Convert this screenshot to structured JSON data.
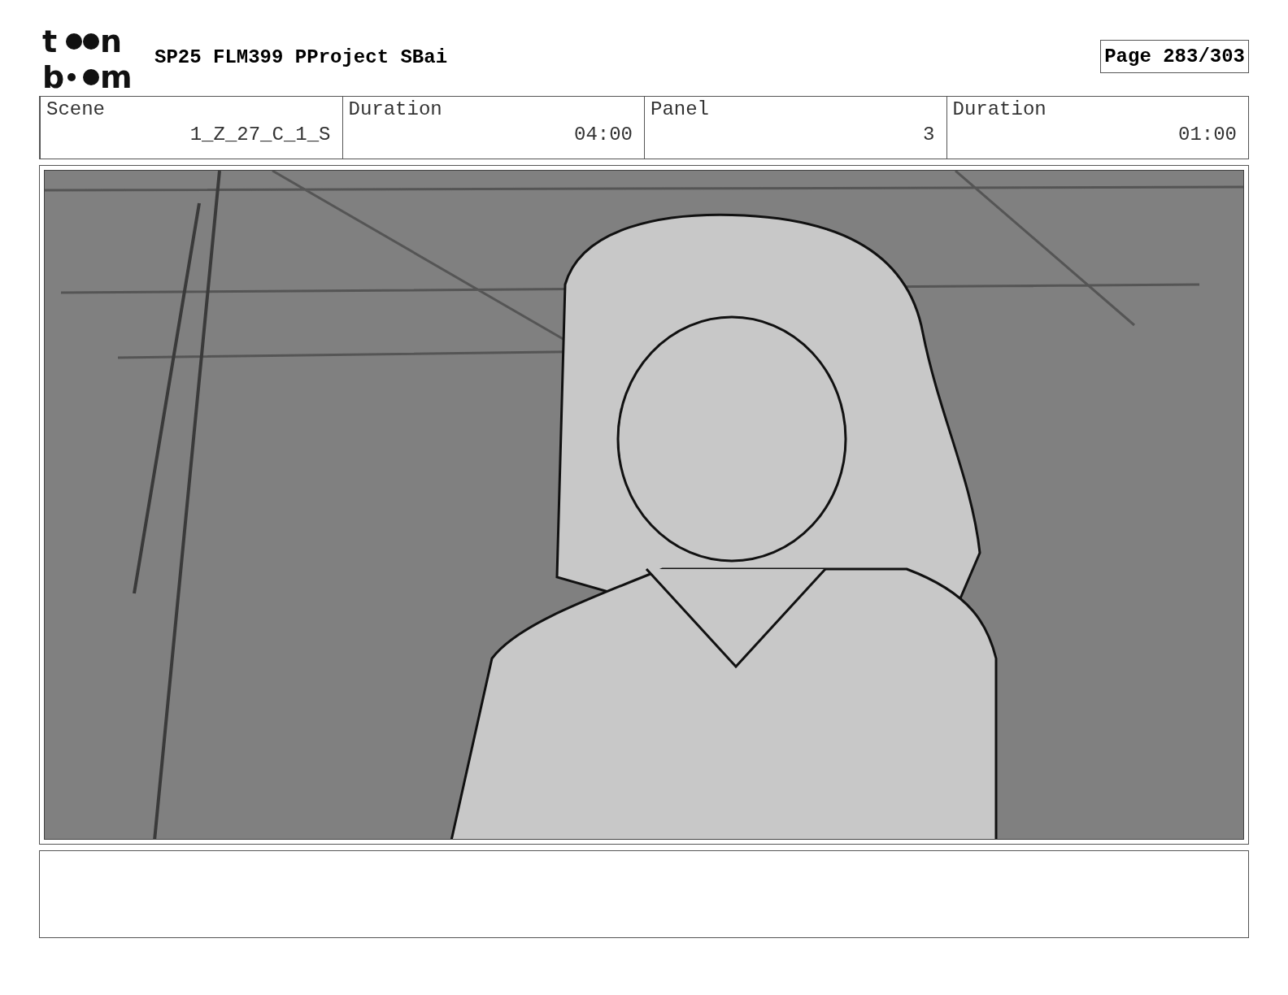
{
  "header": {
    "logo": {
      "top": [
        "t",
        "n"
      ],
      "bottom": [
        "b",
        "m"
      ]
    },
    "title": "SP25 FLM399 PProject SBai",
    "page": "Page 283/303"
  },
  "info": [
    {
      "label": "Scene",
      "value": "1_Z_27_C_1_S"
    },
    {
      "label": "Duration",
      "value": "04:00"
    },
    {
      "label": "Panel",
      "value": "3"
    },
    {
      "label": "Duration",
      "value": "01:00"
    }
  ]
}
